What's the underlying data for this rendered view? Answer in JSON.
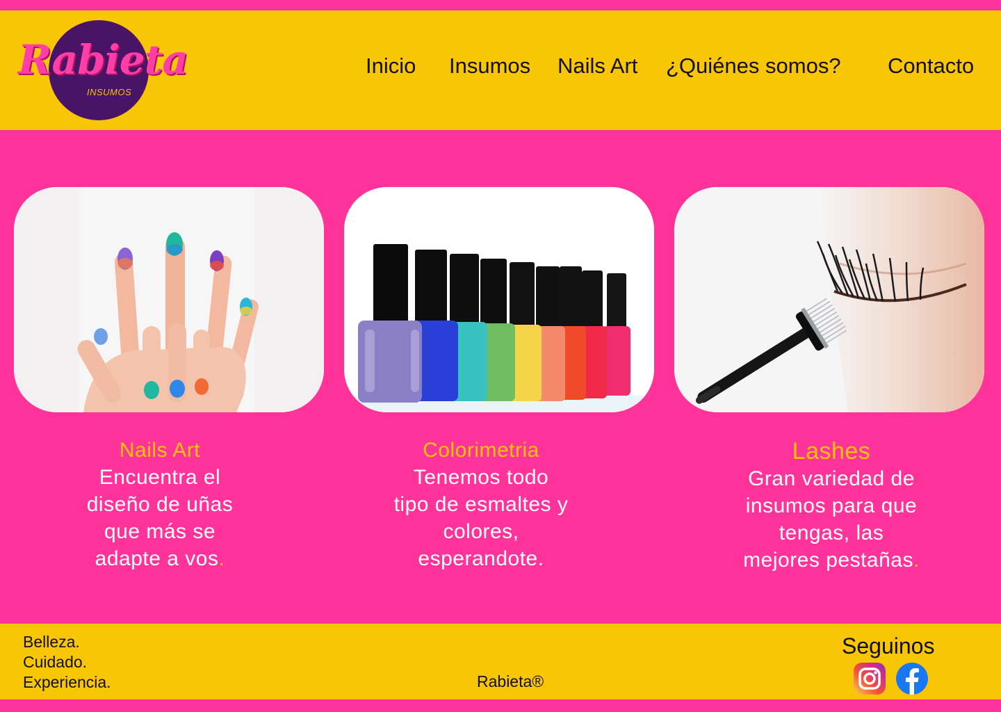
{
  "brand": {
    "logo_word": "Rabieta",
    "logo_sub": "INSUMOS"
  },
  "nav": {
    "items": [
      {
        "label": "Inicio"
      },
      {
        "label": "Insumos"
      },
      {
        "label": "Nails Art"
      },
      {
        "label": "¿Quiénes somos?"
      },
      {
        "label": "Contacto"
      }
    ]
  },
  "cards": [
    {
      "title": "Nails Art",
      "line1": "Encuentra el",
      "line2": "diseño de uñas",
      "line3": "que más se",
      "line4": "adapte a vos",
      "dot": "."
    },
    {
      "title": "Colorimetria",
      "line1": "Tenemos todo",
      "line2": "tipo de esmaltes y",
      "line3": "colores,",
      "line4": "esperandote."
    },
    {
      "title": "Lashes",
      "line1": "Gran variedad de",
      "line2": "insumos para que",
      "line3": "tengas, las",
      "line4": "mejores pestañas",
      "dot": "."
    }
  ],
  "footer": {
    "tagline": [
      "Belleza.",
      "Cuidado.",
      "Experiencia."
    ],
    "brand": "Rabieta®",
    "follow": "Seguinos",
    "social": [
      {
        "icon": "instagram-icon"
      },
      {
        "icon": "facebook-icon"
      }
    ]
  },
  "colors": {
    "pink": "#FF3399",
    "yellow": "#F8C507",
    "purple": "#4A1466"
  }
}
